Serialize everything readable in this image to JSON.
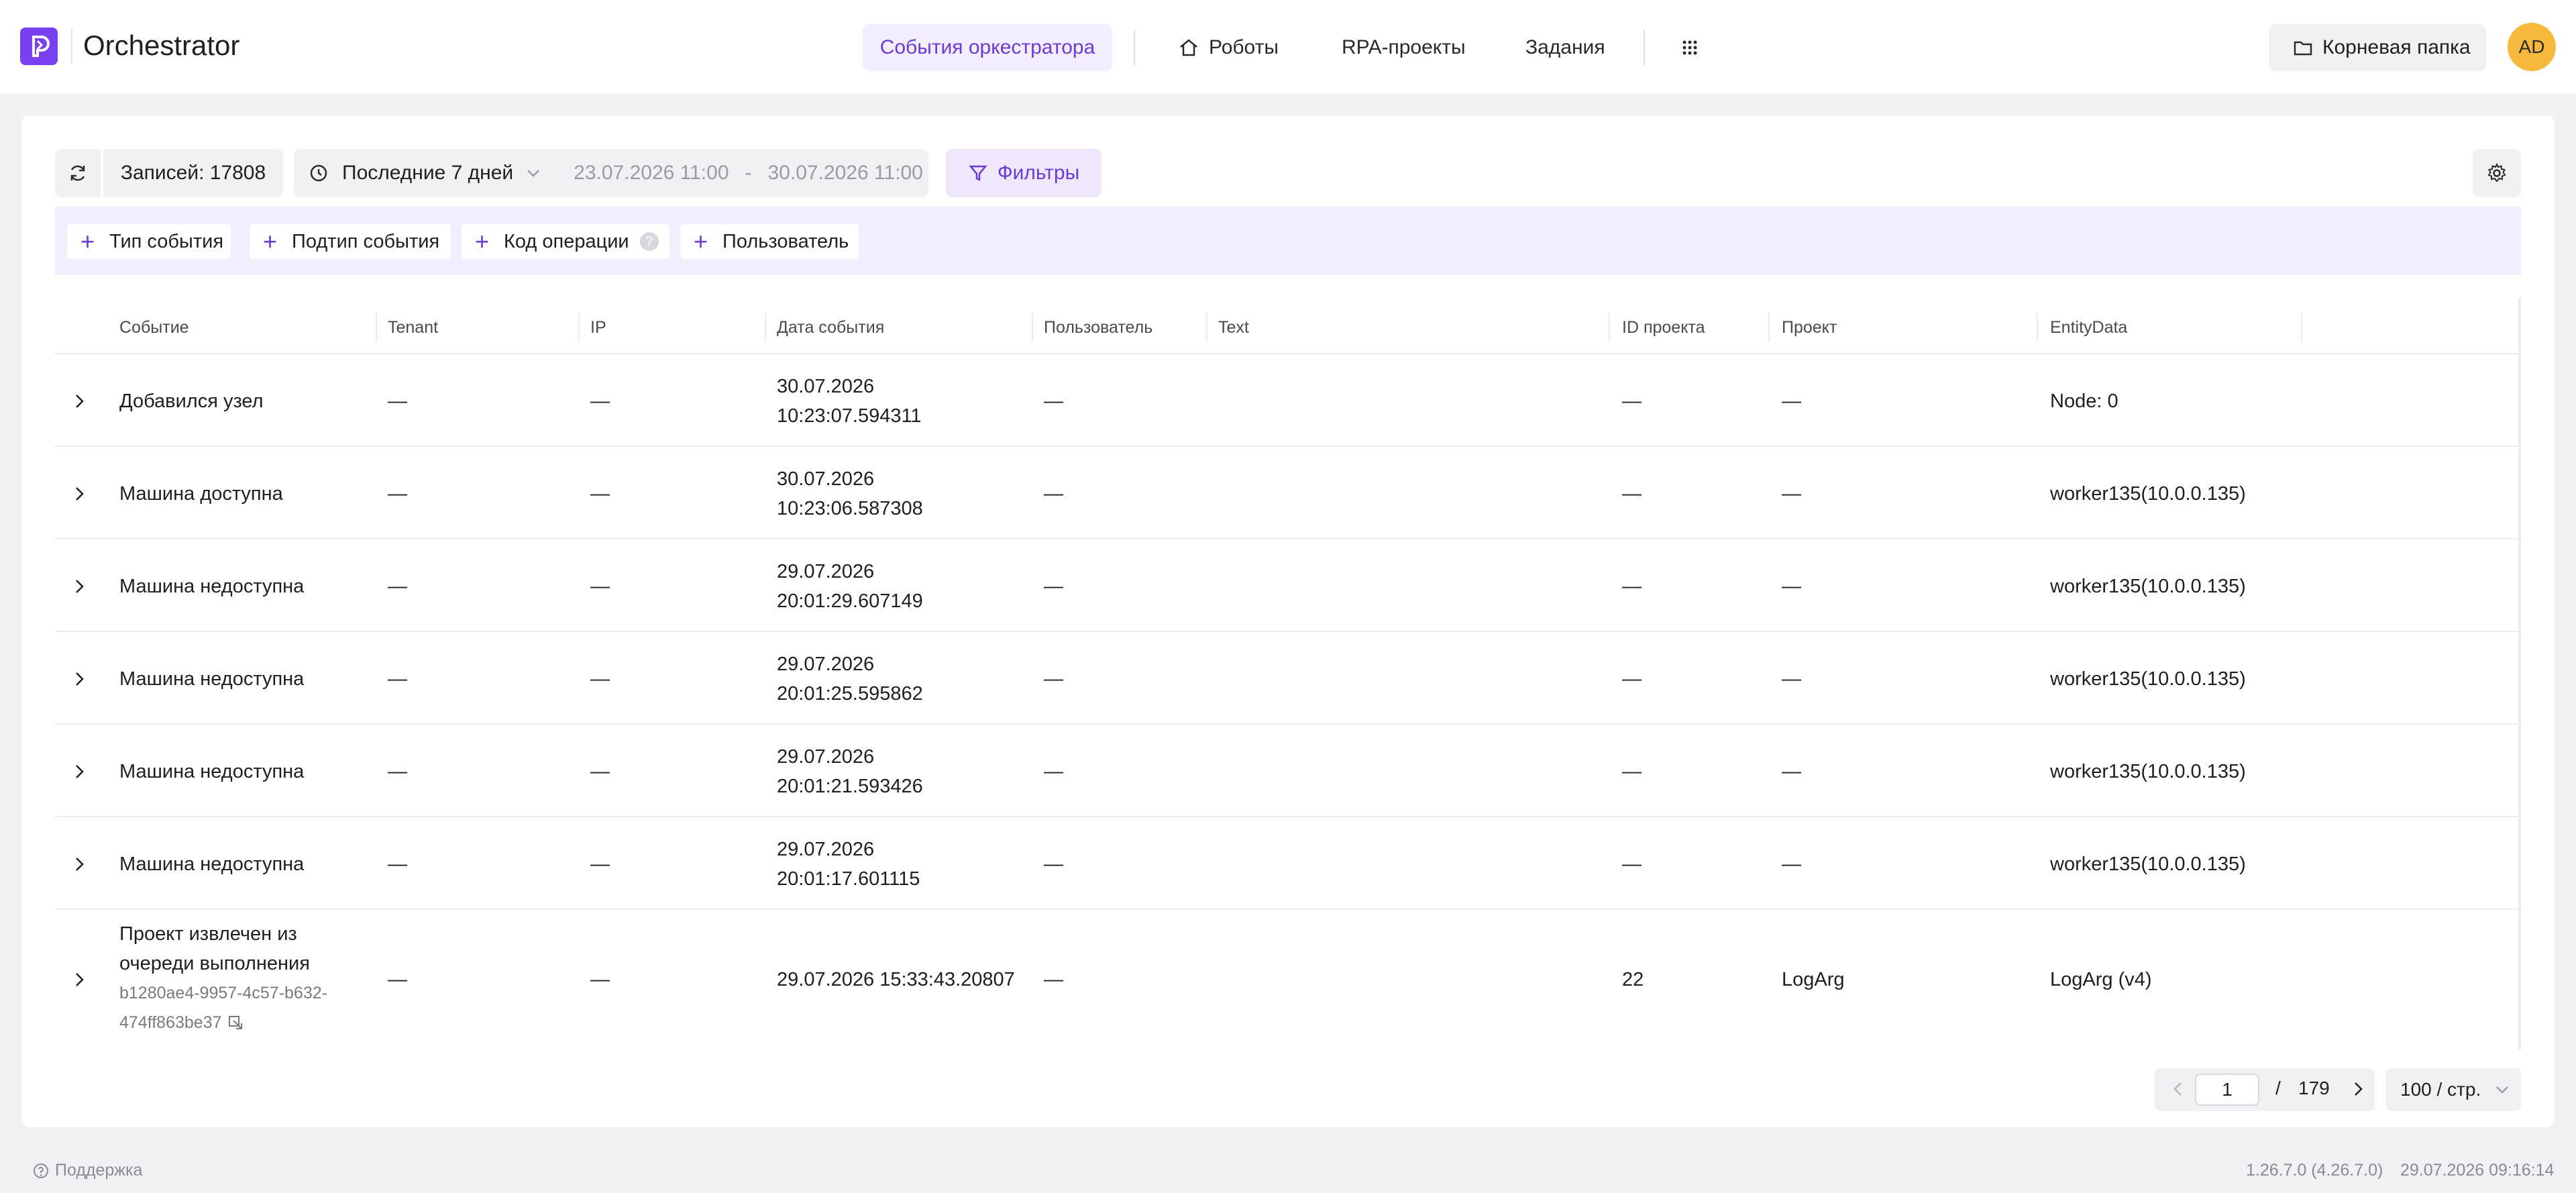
{
  "header": {
    "app_title": "Orchestrator",
    "nav": {
      "active": "События оркестратора",
      "robots": "Роботы",
      "rpa_projects": "RPA-проекты",
      "tasks": "Задания"
    },
    "root_folder": "Корневая папка",
    "avatar_initials": "AD"
  },
  "toolbar": {
    "records_label": "Записей: 17808",
    "period_label": "Последние 7 дней",
    "date_from": "23.07.2026 11:00",
    "date_separator": "-",
    "date_to": "30.07.2026 11:00",
    "filters_label": "Фильтры"
  },
  "filter_chips": {
    "event_type": "Тип события",
    "event_subtype": "Подтип события",
    "operation_code": "Код операции",
    "operation_help": "?",
    "user": "Пользователь"
  },
  "table": {
    "columns": {
      "event": "Событие",
      "tenant": "Tenant",
      "ip": "IP",
      "date": "Дата события",
      "user": "Пользователь",
      "text": "Text",
      "project_id": "ID проекта",
      "project": "Проект",
      "entity_data": "EntityData"
    },
    "rows": [
      {
        "event": "Добавился узел",
        "tenant": "—",
        "ip": "—",
        "date_line1": "30.07.2026",
        "date_line2": "10:23:07.594311",
        "user": "—",
        "project_id": "—",
        "project": "—",
        "entity_data": "Node: 0"
      },
      {
        "event": "Машина доступна",
        "tenant": "—",
        "ip": "—",
        "date_line1": "30.07.2026",
        "date_line2": "10:23:06.587308",
        "user": "—",
        "project_id": "—",
        "project": "—",
        "entity_data": "worker135(10.0.0.135)"
      },
      {
        "event": "Машина недоступна",
        "tenant": "—",
        "ip": "—",
        "date_line1": "29.07.2026",
        "date_line2": "20:01:29.607149",
        "user": "—",
        "project_id": "—",
        "project": "—",
        "entity_data": "worker135(10.0.0.135)"
      },
      {
        "event": "Машина недоступна",
        "tenant": "—",
        "ip": "—",
        "date_line1": "29.07.2026",
        "date_line2": "20:01:25.595862",
        "user": "—",
        "project_id": "—",
        "project": "—",
        "entity_data": "worker135(10.0.0.135)"
      },
      {
        "event": "Машина недоступна",
        "tenant": "—",
        "ip": "—",
        "date_line1": "29.07.2026",
        "date_line2": "20:01:21.593426",
        "user": "—",
        "project_id": "—",
        "project": "—",
        "entity_data": "worker135(10.0.0.135)"
      },
      {
        "event": "Машина недоступна",
        "tenant": "—",
        "ip": "—",
        "date_line1": "29.07.2026",
        "date_line2": "20:01:17.601115",
        "user": "—",
        "project_id": "—",
        "project": "—",
        "entity_data": "worker135(10.0.0.135)"
      },
      {
        "event_line1": "Проект извлечен из",
        "event_line2": "очереди выполнения",
        "sub_id_line1": "b1280ae4-9957-4c57-b632-",
        "sub_id_line2": "474ff863be37",
        "tenant": "—",
        "ip": "—",
        "date": "29.07.2026 15:33:43.20807",
        "user": "—",
        "project_id": "22",
        "project": "LogArg",
        "entity_data": "LogArg (v4)"
      }
    ]
  },
  "pagination": {
    "current_page": "1",
    "separator": "/",
    "total_pages": "179",
    "per_page": "100 / стр."
  },
  "footer": {
    "support": "Поддержка",
    "version": "1.26.7.0 (4.26.7.0)",
    "datetime": "29.07.2026 09:16:14"
  },
  "colors": {
    "accent": "#6a3bd8",
    "logo_bg": "#7b3ff2",
    "avatar_bg": "#f6b93b",
    "filter_bar_bg": "#f3eefe"
  },
  "icons": {
    "logo": "orchestrator-logo-icon",
    "home": "home-icon",
    "apps": "apps-grid-icon",
    "folder": "folder-icon",
    "refresh": "refresh-icon",
    "clock": "clock-icon",
    "filter": "filter-icon",
    "settings": "gear-icon",
    "plus": "plus-icon",
    "expand": "chevron-right-icon",
    "copy": "copy-icon",
    "support": "help-circle-icon"
  }
}
